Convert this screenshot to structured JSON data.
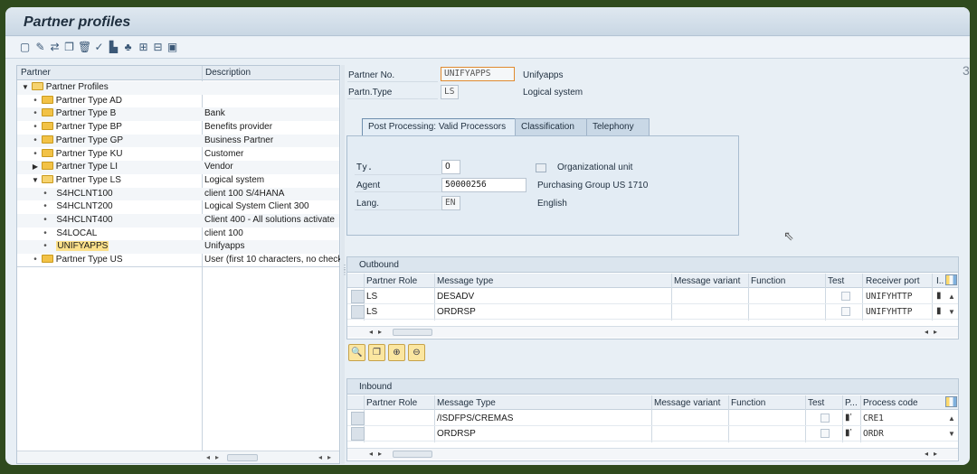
{
  "window": {
    "title": "Partner profiles"
  },
  "toolbar": {
    "icons": [
      "new-icon",
      "edit-icon",
      "change-icon",
      "copy-icon",
      "delete-icon",
      "where-used-icon",
      "check-icon",
      "tree-icon",
      "export-icon",
      "import-icon",
      "display-icon"
    ]
  },
  "tree": {
    "col_partner": "Partner",
    "col_description": "Description",
    "rows": [
      {
        "label": "Partner Profiles",
        "desc": ""
      },
      {
        "label": "Partner Type AD",
        "desc": ""
      },
      {
        "label": "Partner Type B",
        "desc": "Bank"
      },
      {
        "label": "Partner Type BP",
        "desc": "Benefits provider"
      },
      {
        "label": "Partner Type GP",
        "desc": "Business Partner"
      },
      {
        "label": "Partner Type KU",
        "desc": "Customer"
      },
      {
        "label": "Partner Type LI",
        "desc": "Vendor"
      },
      {
        "label": "Partner Type LS",
        "desc": "Logical system"
      },
      {
        "label": "S4HCLNT100",
        "desc": "client 100 S/4HANA"
      },
      {
        "label": "S4HCLNT200",
        "desc": " Logical System Client 300"
      },
      {
        "label": "S4HCLNT400",
        "desc": "Client 400 - All solutions activate"
      },
      {
        "label": "S4LOCAL",
        "desc": "client 100"
      },
      {
        "label": "UNIFYAPPS",
        "desc": "Unifyapps"
      },
      {
        "label": "Partner Type US",
        "desc": "User (first 10 characters, no check"
      }
    ]
  },
  "header": {
    "partner_no_label": "Partner No.",
    "partner_no_value": "UNIFYAPPS",
    "partner_no_text": "Unifyapps",
    "partn_type_label": "Partn.Type",
    "partn_type_value": "LS",
    "partn_type_text": "Logical system"
  },
  "tabs": [
    {
      "label": "Post Processing: Valid Processors",
      "active": true
    },
    {
      "label": "Classification",
      "active": false
    },
    {
      "label": "Telephony",
      "active": false
    }
  ],
  "post_processing": {
    "ty_label": "Ty.",
    "ty_value": "O",
    "ty_text": "Organizational unit",
    "agent_label": "Agent",
    "agent_value": "50000256",
    "agent_text": "Purchasing Group US 1710",
    "lang_label": "Lang.",
    "lang_value": "EN",
    "lang_text": "English"
  },
  "outbound": {
    "title": "Outbound",
    "columns": [
      "Partner Role",
      "Message type",
      "Message variant",
      "Function",
      "Test",
      "Receiver port",
      "I.."
    ],
    "rows": [
      {
        "role": "LS",
        "message_type": "DESADV",
        "variant": "",
        "function": "",
        "port": "UNIFYHTTP"
      },
      {
        "role": "LS",
        "message_type": "ORDRSP",
        "variant": "",
        "function": "",
        "port": "UNIFYHTTP"
      }
    ]
  },
  "inbound": {
    "title": "Inbound",
    "columns": [
      "Partner Role",
      "Message Type",
      "Message variant",
      "Function",
      "Test",
      "P...",
      "Process code"
    ],
    "rows": [
      {
        "role": "",
        "message_type": "/ISDFPS/CREMAS",
        "variant": "",
        "function": "",
        "process_code": "CRE1"
      },
      {
        "role": "",
        "message_type": "ORDRSP",
        "variant": "",
        "function": "",
        "process_code": "ORDR"
      }
    ]
  },
  "colors": {
    "folder": "#f2c246",
    "selection": "#fbe08a",
    "tab_active": "#e3edf6",
    "action_button": "#fbe6a0"
  }
}
